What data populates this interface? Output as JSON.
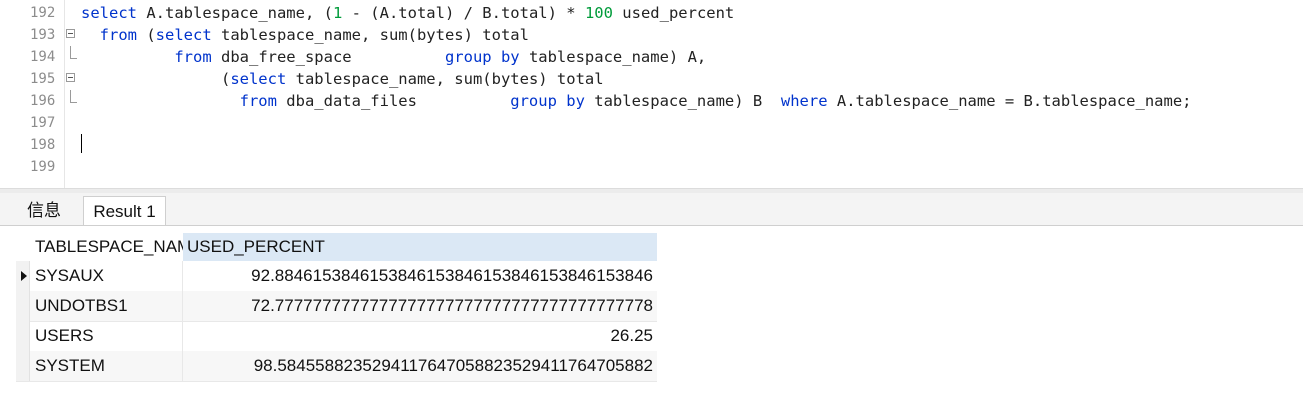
{
  "editor": {
    "line_numbers": [
      "192",
      "193",
      "194",
      "195",
      "196",
      "197",
      "198",
      "199"
    ],
    "lines": [
      [
        {
          "t": "select",
          "c": "kw"
        },
        {
          "t": " A.tablespace_name, ("
        },
        {
          "t": "1",
          "c": "num-lit"
        },
        {
          "t": " - (A.total) / B.total) * "
        },
        {
          "t": "100",
          "c": "num-lit"
        },
        {
          "t": " used_percent"
        }
      ],
      [
        {
          "t": "  "
        },
        {
          "t": "from",
          "c": "kw"
        },
        {
          "t": " ("
        },
        {
          "t": "select",
          "c": "kw"
        },
        {
          "t": " tablespace_name, sum(bytes) total"
        }
      ],
      [
        {
          "t": "          "
        },
        {
          "t": "from",
          "c": "kw"
        },
        {
          "t": " dba_free_space          "
        },
        {
          "t": "group by",
          "c": "kw"
        },
        {
          "t": " tablespace_name) A,"
        }
      ],
      [
        {
          "t": "               ("
        },
        {
          "t": "select",
          "c": "kw"
        },
        {
          "t": " tablespace_name, sum(bytes) total"
        }
      ],
      [
        {
          "t": "                 "
        },
        {
          "t": "from",
          "c": "kw"
        },
        {
          "t": " dba_data_files          "
        },
        {
          "t": "group by",
          "c": "kw"
        },
        {
          "t": " tablespace_name) B  "
        },
        {
          "t": "where",
          "c": "kw"
        },
        {
          "t": " A.tablespace_name = B.tablespace_name;"
        }
      ],
      [],
      [],
      []
    ]
  },
  "tabs": {
    "info_label": "信息",
    "result_label": "Result 1"
  },
  "grid": {
    "columns": [
      "TABLESPACE_NAME",
      "USED_PERCENT"
    ],
    "rows": [
      {
        "name": "SYSAUX",
        "used_percent": "92.8846153846153846153846153846153846153846"
      },
      {
        "name": "UNDOTBS1",
        "used_percent": "72.7777777777777777777777777777777777777778"
      },
      {
        "name": "USERS",
        "used_percent": "26.25"
      },
      {
        "name": "SYSTEM",
        "used_percent": "98.5845588235294117647058823529411764705882"
      }
    ]
  }
}
